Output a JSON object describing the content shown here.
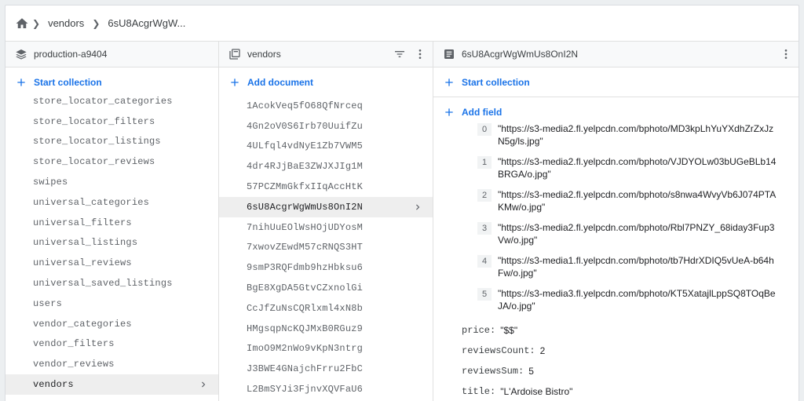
{
  "breadcrumb": {
    "vendors": "vendors",
    "doc": "6sU8AcgrWgW..."
  },
  "col1": {
    "title": "production-a9404",
    "action": "Start collection",
    "items": [
      "store_locator_categories",
      "store_locator_filters",
      "store_locator_listings",
      "store_locator_reviews",
      "swipes",
      "universal_categories",
      "universal_filters",
      "universal_listings",
      "universal_reviews",
      "universal_saved_listings",
      "users",
      "vendor_categories",
      "vendor_filters",
      "vendor_reviews",
      "vendors"
    ],
    "selected": "vendors"
  },
  "col2": {
    "title": "vendors",
    "action": "Add document",
    "items": [
      "1AcokVeq5fO68QfNrceq",
      "4Gn2oV0S6Irb70UuifZu",
      "4ULfql4vdNyE1Zb7VWM5",
      "4dr4RJjBaE3ZWJXJIg1M",
      "57PCZMmGkfxIIqAccHtK",
      "6sU8AcgrWgWmUs8OnI2N",
      "7nihUuEOlWsHOjUDYosM",
      "7xwovZEwdM57cRNQS3HT",
      "9smP3RQFdmb9hzHbksu6",
      "BgE8XgDA5GtvCZxnolGi",
      "CcJfZuNsCQRlxml4xN8b",
      "HMgsqpNcKQJMxB0RGuz9",
      "ImoO9M2nWo9vKpN3ntrg",
      "J3BWE4GNajchFrru2FbC",
      "L2BmSYJi3FjnvXQVFaU6"
    ],
    "selected": "6sU8AcgrWgWmUs8OnI2N"
  },
  "col3": {
    "title": "6sU8AcgrWgWmUs8OnI2N",
    "action_collection": "Start collection",
    "action_field": "Add field",
    "array_items": [
      {
        "index": "0",
        "value": "\"https://s3-media2.fl.yelpcdn.com/bphoto/MD3kpLhYuYXdhZrZxJzN5g/ls.jpg\""
      },
      {
        "index": "1",
        "value": "\"https://s3-media2.fl.yelpcdn.com/bphoto/VJDYOLw03bUGeBLb14BRGA/o.jpg\""
      },
      {
        "index": "2",
        "value": "\"https://s3-media2.fl.yelpcdn.com/bphoto/s8nwa4WvyVb6J074PTAKMw/o.jpg\""
      },
      {
        "index": "3",
        "value": "\"https://s3-media2.fl.yelpcdn.com/bphoto/Rbl7PNZY_68iday3Fup3Vw/o.jpg\""
      },
      {
        "index": "4",
        "value": "\"https://s3-media1.fl.yelpcdn.com/bphoto/tb7HdrXDIQ5vUeA-b64hFw/o.jpg\""
      },
      {
        "index": "5",
        "value": "\"https://s3-media3.fl.yelpcdn.com/bphoto/KT5XatajlLppSQ8TOqBeJA/o.jpg\""
      }
    ],
    "fields": [
      {
        "key": "price:",
        "value": "\"$$\""
      },
      {
        "key": "reviewsCount:",
        "value": "2"
      },
      {
        "key": "reviewsSum:",
        "value": "5"
      },
      {
        "key": "title:",
        "value": "\"L'Ardoise Bistro\""
      }
    ]
  },
  "colors": {
    "accent": "#1a73e8",
    "selected_bg": "#eeeeee"
  }
}
